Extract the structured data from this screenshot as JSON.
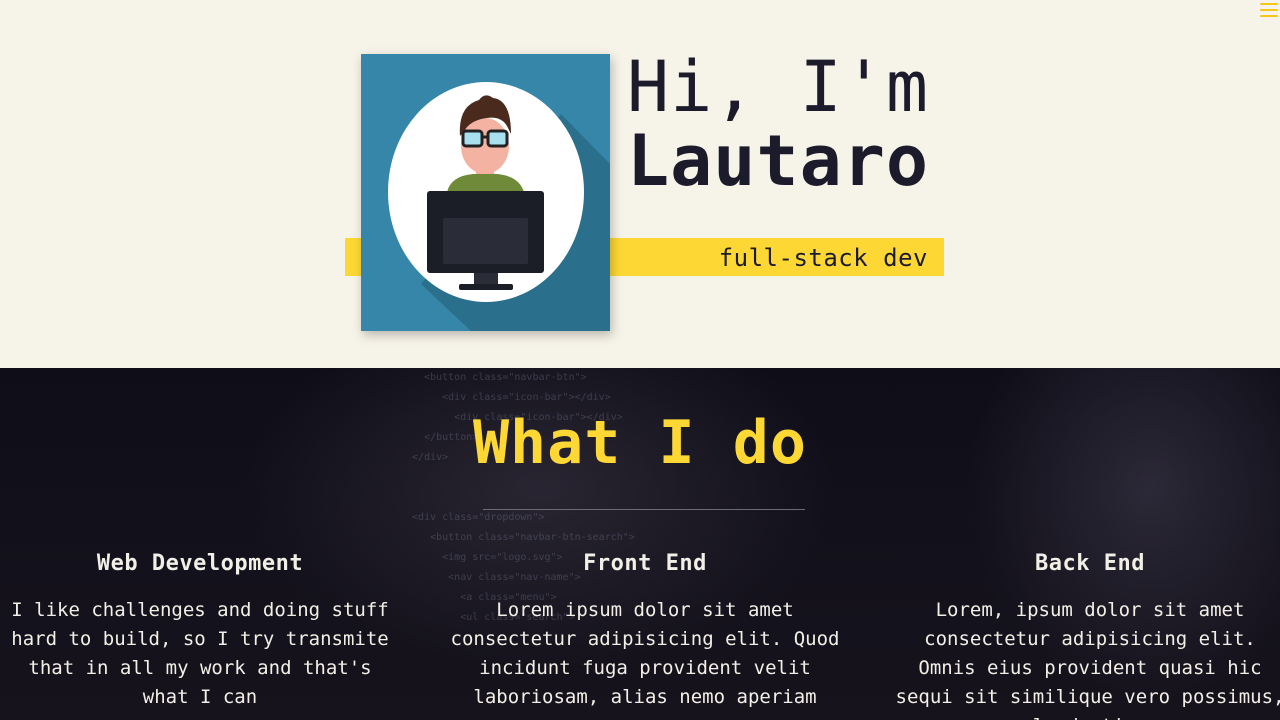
{
  "nav": {
    "menu_icon": "hamburger-icon",
    "accent": "#f5c518"
  },
  "hero": {
    "greeting": "Hi, I'm",
    "name": "Lautaro",
    "tagline": "full-stack dev",
    "avatar_icon": "developer-avatar-icon",
    "colors": {
      "background": "#f6f3e8",
      "accent_bar": "#fdd835",
      "card": "#3586a8",
      "text": "#1c1b2b"
    }
  },
  "services": {
    "title": "What I do",
    "items": [
      {
        "heading": "Web Development",
        "text": "I like challenges and doing stuff hard to build, so I try transmite that in all my work and that's what I can"
      },
      {
        "heading": "Front End",
        "text": "Lorem ipsum dolor sit amet consectetur adipisicing elit. Quod incidunt fuga provident velit laboriosam, alias nemo aperiam"
      },
      {
        "heading": "Back End",
        "text": "Lorem, ipsum dolor sit amet consectetur adipisicing elit. Omnis eius provident quasi hic sequi sit similique vero possimus, laudantium"
      }
    ],
    "colors": {
      "title": "#fdd835",
      "text": "#f2efe6"
    }
  }
}
